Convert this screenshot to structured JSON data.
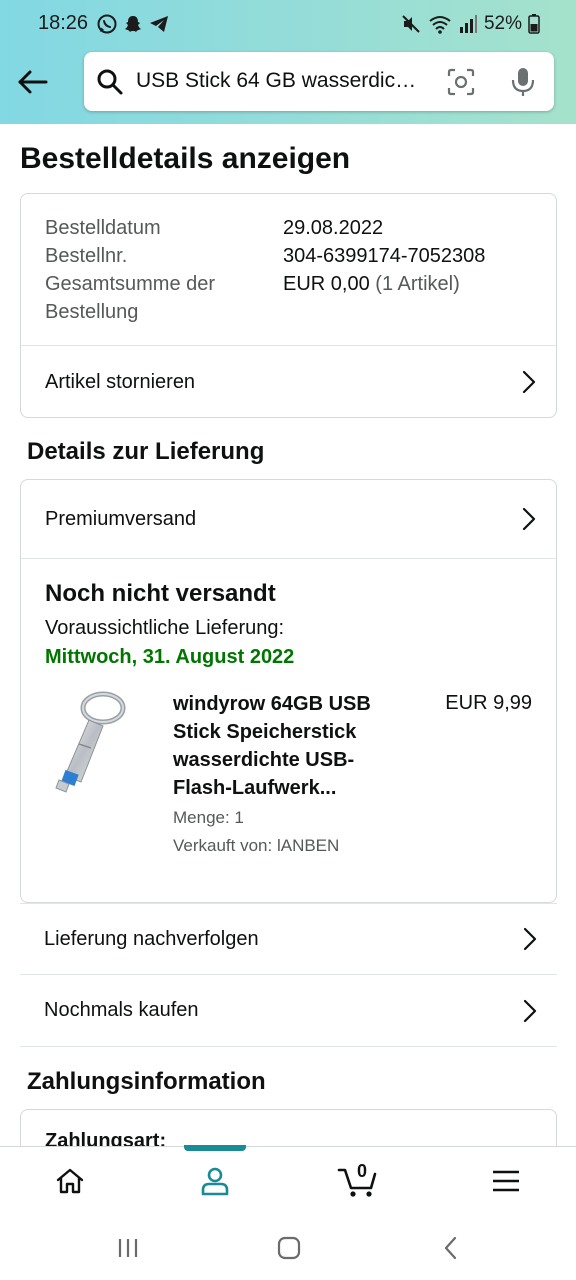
{
  "status_bar": {
    "time": "18:26",
    "battery": "52%"
  },
  "search": {
    "value": "USB Stick 64 GB wasserdic…"
  },
  "page": {
    "title": "Bestelldetails anzeigen"
  },
  "order_summary": {
    "rows": [
      {
        "label": "Bestelldatum",
        "value": "29.08.2022"
      },
      {
        "label": "Bestellnr.",
        "value": "304-6399174-7052308"
      },
      {
        "label_line1": "Gesamtsumme der",
        "label_line2": "Bestellung",
        "value": "EUR 0,00",
        "value_extra": "(1 Artikel)"
      }
    ],
    "cancel_link": "Artikel stornieren"
  },
  "delivery": {
    "section_title": "Details zur Lieferung",
    "shipping_method": "Premiumversand",
    "status": "Noch nicht versandt",
    "expected_label": "Voraussichtliche Lieferung:",
    "expected_date": "Mittwoch, 31. August 2022",
    "product": {
      "title": "windyrow 64GB USB Stick Speicherstick wasserdichte USB-Flash-Laufwerk...",
      "price": "EUR 9,99",
      "quantity": "Menge: 1",
      "seller": "Verkauft von: lANBEN"
    },
    "track_link": "Lieferung nachverfolgen",
    "buy_again_link": "Nochmals kaufen"
  },
  "payment": {
    "section_title": "Zahlungsinformation",
    "payment_method_label": "Zahlungsart:"
  },
  "bottom_nav": {
    "cart_count": "0",
    "active": "account",
    "accent_color": "#1a8a96"
  },
  "colors": {
    "delivery_date": "#007600",
    "header_gradient_start": "#82d8e3",
    "header_gradient_end": "#a5e2cc"
  }
}
